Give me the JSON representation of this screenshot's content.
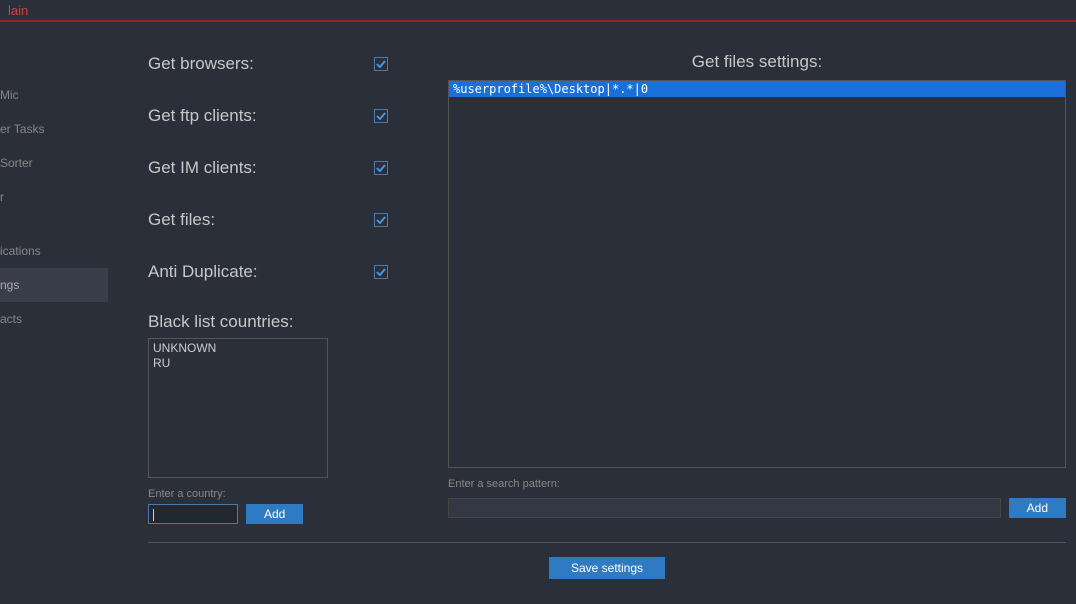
{
  "titlebar": {
    "title": "lain"
  },
  "sidebar": {
    "items": [
      {
        "label": "Mic"
      },
      {
        "label": "er Tasks"
      },
      {
        "label": "Sorter"
      },
      {
        "label": "r"
      },
      {
        "label": "ications"
      },
      {
        "label": "ngs",
        "active": true
      },
      {
        "label": "acts"
      }
    ]
  },
  "settings": {
    "checks": {
      "get_browsers": {
        "label": "Get browsers:",
        "checked": true
      },
      "get_ftp": {
        "label": "Get ftp clients:",
        "checked": true
      },
      "get_im": {
        "label": "Get IM clients:",
        "checked": true
      },
      "get_files": {
        "label": "Get files:",
        "checked": true
      },
      "anti_duplicate": {
        "label": "Anti Duplicate:",
        "checked": true
      }
    },
    "blacklist": {
      "heading": "Black list countries:",
      "items": [
        "UNKNOWN",
        "RU"
      ],
      "input_label": "Enter a country:",
      "input_value": "",
      "add_button": "Add"
    },
    "files": {
      "heading": "Get files settings:",
      "lines": [
        "%userprofile%\\Desktop|*.*|0"
      ],
      "input_label": "Enter a search pattern:",
      "input_value": "",
      "add_button": "Add"
    },
    "save_button": "Save settings"
  }
}
